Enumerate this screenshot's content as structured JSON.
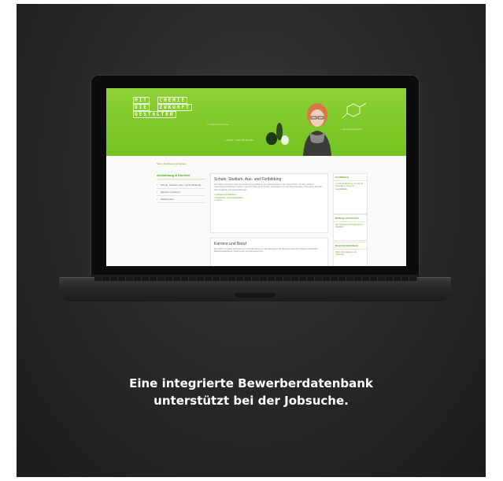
{
  "website": {
    "logo_rows": [
      [
        "MIT",
        "CHEMIE"
      ],
      [
        "DIE",
        "ZUKUNFT"
      ],
      [
        "GESTALTEN"
      ]
    ],
    "header_links": [
      "» Zukunftschemie ...",
      "» FORT- UND BILDUNG",
      "» Stellenangebote"
    ],
    "breadcrumb": "Start | Ausbildung & Karriere",
    "leftnav": {
      "title": "Ausbildung & Karriere",
      "items": [
        "Schule, Studium, Aus- und Fortbildung",
        "Karriere und Beruf",
        "Stellenmarkt"
      ]
    },
    "cards": [
      {
        "title": "Schule, Studium, Aus- und Fortbildung",
        "text": "Die GDCh unterstützt aktiv die Förderung und Bildung des Nachwuchses in den chemischen und den weiteren naturwissenschaftlichen Fächern. Auf dem Weg durch Schule und Studium bis zum Berufseinstieg. Informieren Sie sich über Angebote und Veranstaltungen.",
        "links": [
          "» Schüler und Studium",
          "» Studenten und Doktoranden",
          "» Lehre"
        ]
      },
      {
        "title": "Karriere und Beruf",
        "text": "Die GDCh vermittelt Informationen und Hilfestellung für den Einstieg in den Beruf als auch für erfahrene Fachkräfte. Bewerberdatenbank, Stellenmarkt und Karriereservice.",
        "links": []
      }
    ],
    "side_boxes": [
      {
        "title": "Fortbildung",
        "body": "» Lehrerfortbildung » Kurse für Chemiker » Kurse für Ausgebildete"
      },
      {
        "title": "Bildung und Karriere",
        "body": "Alle Services und Angebote im Überblick"
      },
      {
        "title": "Bewerberdatenbank",
        "body": "Mehr Informationen zur Jobsuche"
      }
    ]
  },
  "caption": {
    "line1": "Eine integrierte Bewerberdatenbank",
    "line2": "unterstützt bei der Jobsuche."
  },
  "colors": {
    "accent": "#74c21f",
    "background": "#2a2a2c",
    "caption_text": "#ffffff"
  }
}
